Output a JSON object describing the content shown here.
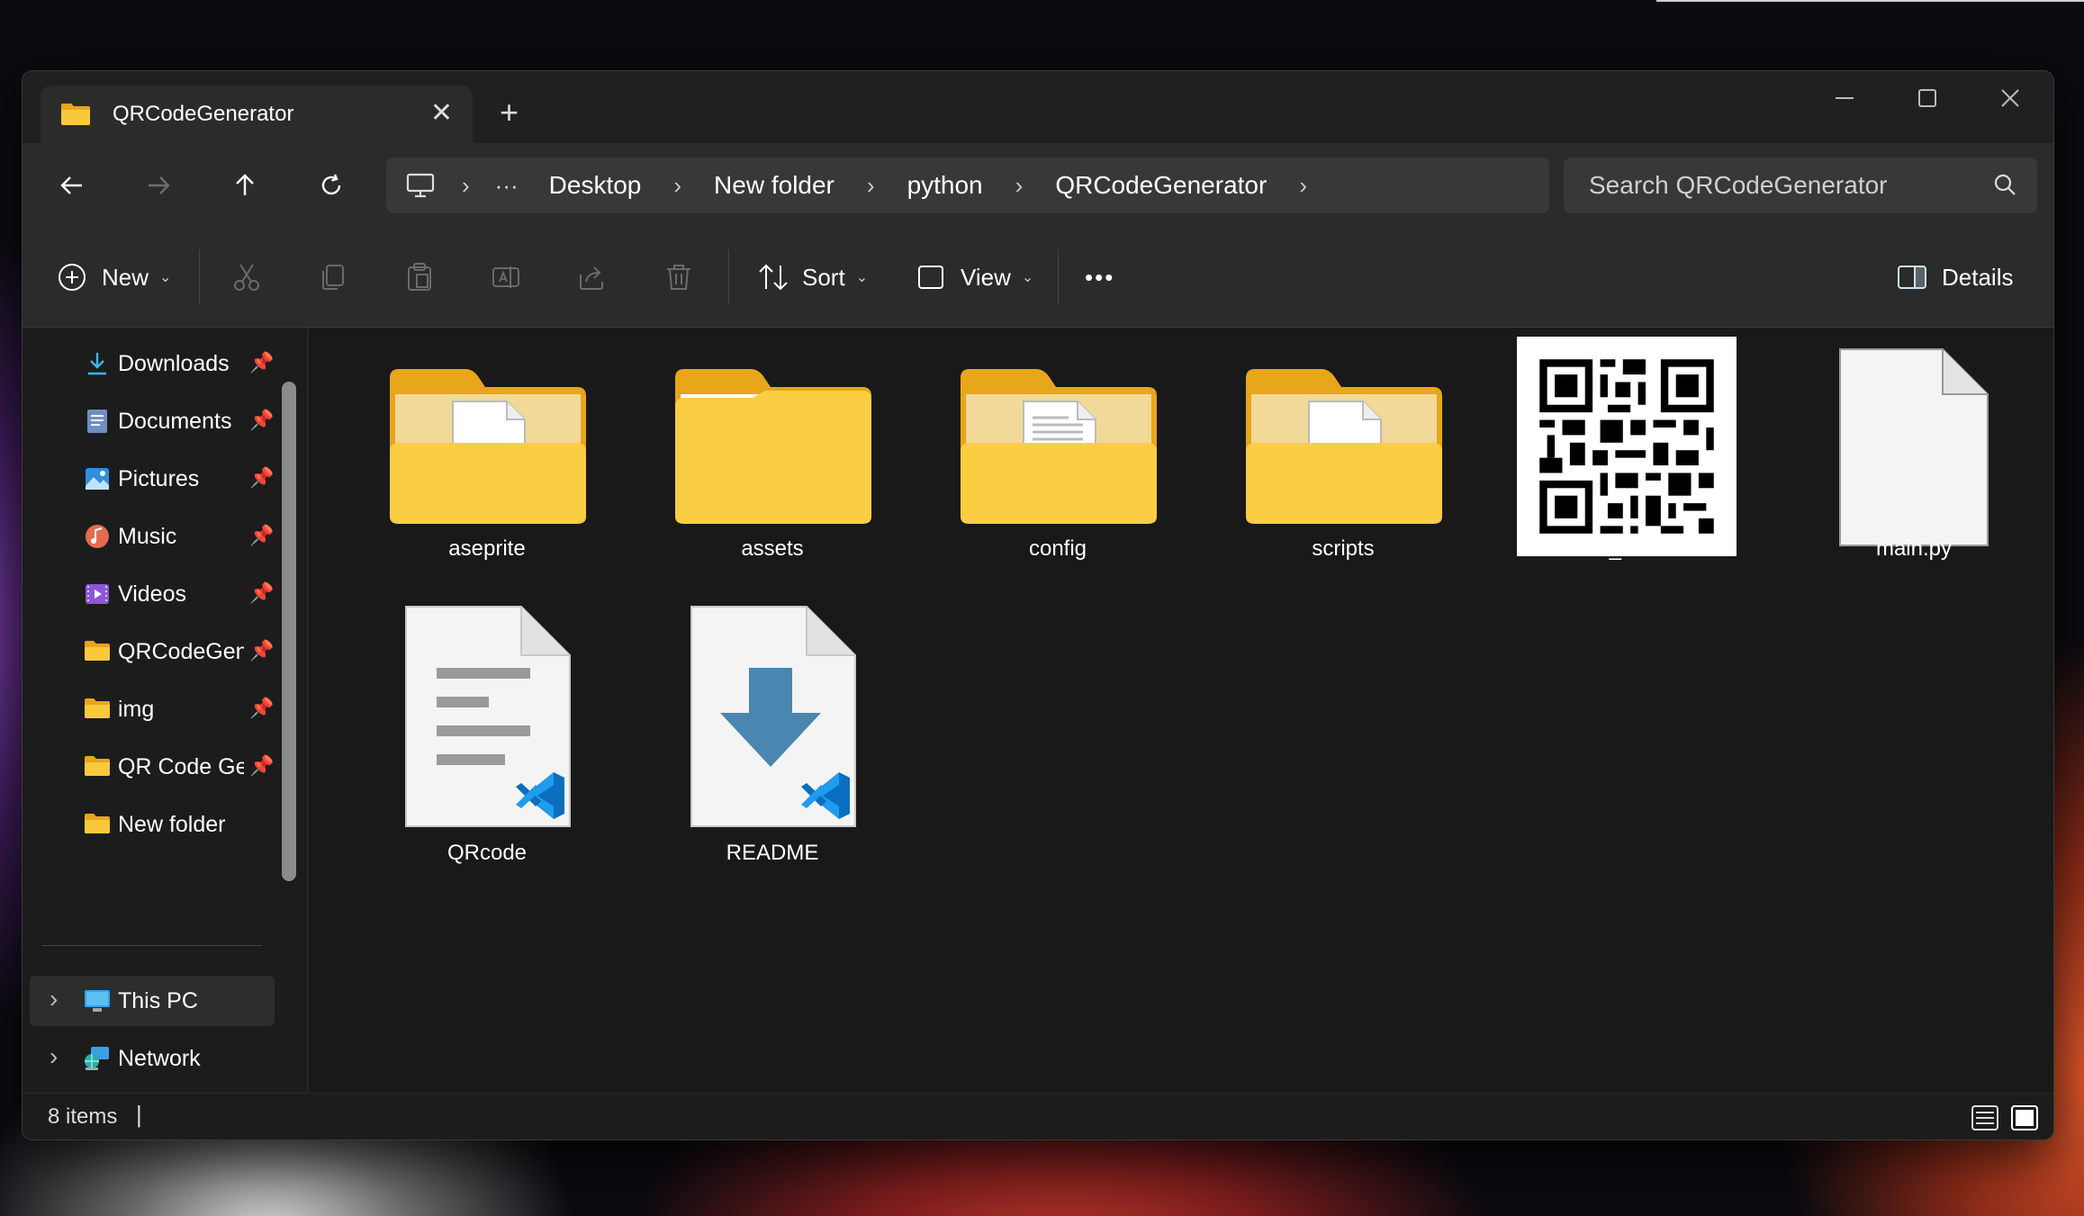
{
  "window": {
    "tab_title": "QRCodeGenerator",
    "new_tab_symbol": "+",
    "close_symbol": "✕"
  },
  "address": {
    "crumbs": [
      "Desktop",
      "New folder",
      "python",
      "QRCodeGenerator"
    ],
    "search_placeholder": "Search QRCodeGenerator"
  },
  "toolbar": {
    "new_label": "New",
    "sort_label": "Sort",
    "view_label": "View",
    "more_label": "•••",
    "details_label": "Details"
  },
  "sidebar": {
    "items": [
      {
        "label": "Downloads",
        "icon": "download-arrow-icon"
      },
      {
        "label": "Documents",
        "icon": "documents-icon"
      },
      {
        "label": "Pictures",
        "icon": "pictures-icon"
      },
      {
        "label": "Music",
        "icon": "music-icon"
      },
      {
        "label": "Videos",
        "icon": "videos-icon"
      },
      {
        "label": "QRCodeGenerator",
        "icon": "folder-icon"
      },
      {
        "label": "img",
        "icon": "folder-icon"
      },
      {
        "label": "QR Code Generator",
        "icon": "folder-icon"
      },
      {
        "label": "New folder",
        "icon": "folder-icon"
      }
    ],
    "this_pc": "This PC",
    "network": "Network"
  },
  "files": [
    {
      "name": "aseprite",
      "type": "folder"
    },
    {
      "name": "assets",
      "type": "folder"
    },
    {
      "name": "config",
      "type": "folder"
    },
    {
      "name": "scripts",
      "type": "folder"
    },
    {
      "name": "file_name",
      "type": "qr-image"
    },
    {
      "name": "main.py",
      "type": "python-file"
    },
    {
      "name": "QRcode",
      "type": "vscode-text-file"
    },
    {
      "name": "README",
      "type": "vscode-markdown-file"
    }
  ],
  "status": {
    "item_count": "8 items",
    "cursor": "|"
  },
  "colors": {
    "folder_front": "#f9c93c",
    "folder_back": "#e8a61a",
    "accent_blue": "#3b9ae1"
  }
}
